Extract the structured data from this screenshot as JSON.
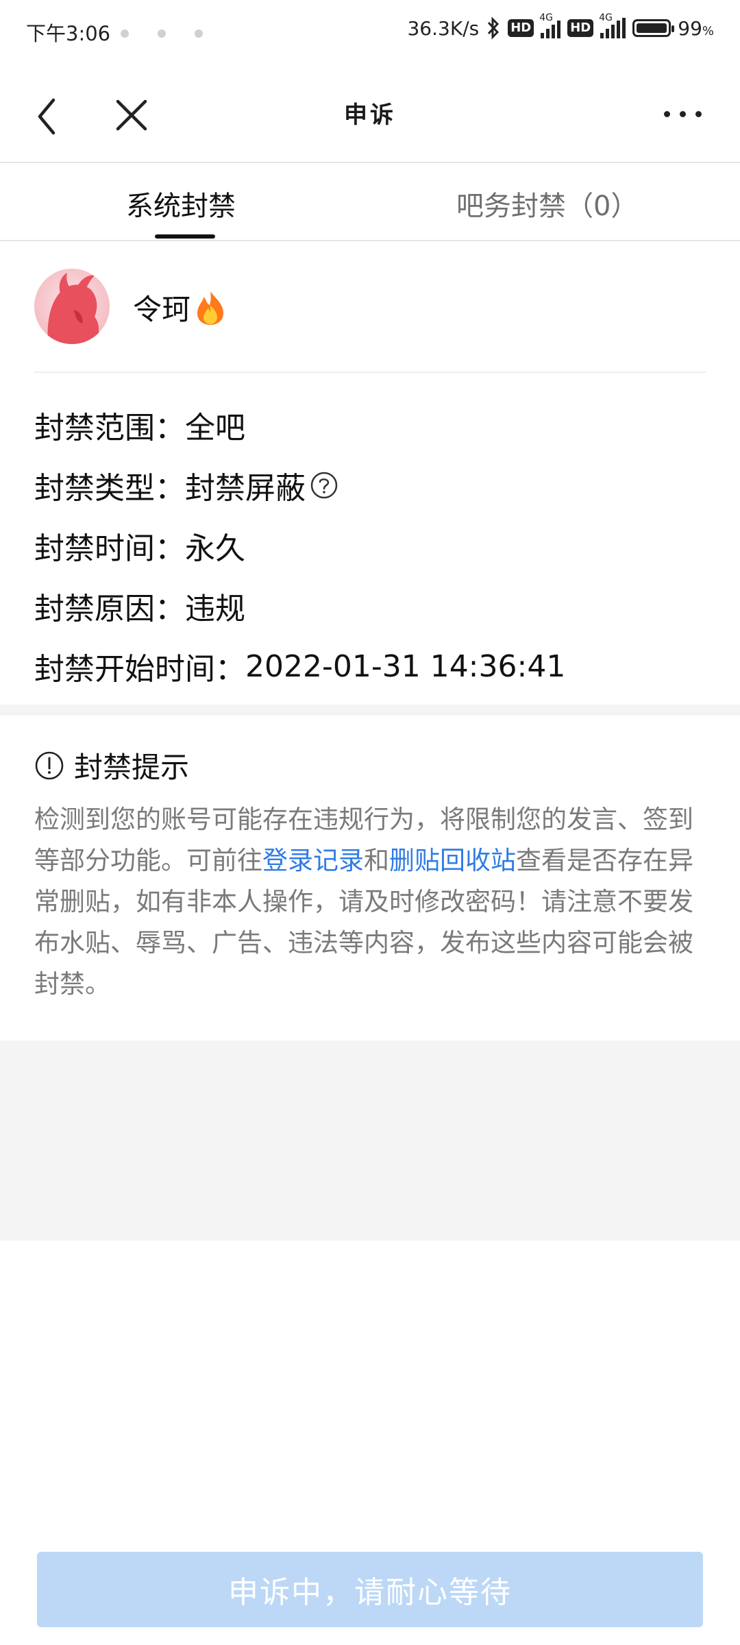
{
  "status_bar": {
    "time": "下午3:06",
    "net_speed": "36.3K/s",
    "hd1": "HD",
    "hd2": "HD",
    "net1": "4G",
    "net2": "4G",
    "battery_pct": "99",
    "battery_unit": "%"
  },
  "nav": {
    "title": "申诉"
  },
  "tabs": [
    {
      "label": "系统封禁",
      "active": true
    },
    {
      "label": "吧务封禁（0）",
      "active": false
    }
  ],
  "profile": {
    "username": "令珂"
  },
  "ban_info": [
    {
      "label": "封禁范围：",
      "value": "全吧"
    },
    {
      "label": "封禁类型：",
      "value": "封禁屏蔽"
    },
    {
      "label": "封禁时间：",
      "value": "永久"
    },
    {
      "label": "封禁原因：",
      "value": "违规"
    },
    {
      "label": "封禁开始时间：",
      "value": "2022-01-31 14:36:41"
    }
  ],
  "tips": {
    "title": "封禁提示",
    "text_before": "检测到您的账号可能存在违规行为，将限制您的发言、签到等部分功能。可前往",
    "link1": "登录记录",
    "conj": "和",
    "link2": "删贴回收站",
    "text_after": "查看是否存在异常删贴，如有非本人操作，请及时修改密码！请注意不要发布水贴、辱骂、广告、违法等内容，发布这些内容可能会被封禁。"
  },
  "appeal_button": "申诉中，请耐心等待",
  "colors": {
    "link": "#2f7ce6",
    "button_disabled": "#bdd8f6",
    "divider": "#e6e6e6"
  }
}
